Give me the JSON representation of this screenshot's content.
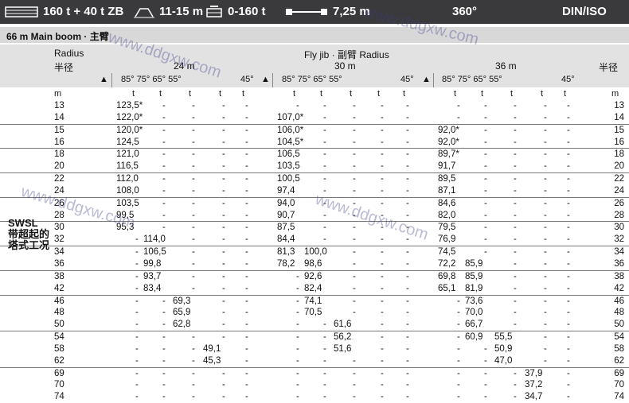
{
  "header": {
    "config": "160 t + 40 t ZB",
    "outrigger": "11-15 m",
    "counterweight": "0-160 t",
    "width": "7,25 m",
    "slew": "360°",
    "standard": "DIN/ISO"
  },
  "subheader": {
    "boom": "66 m  Main boom ·",
    "boom_cn": "主臂"
  },
  "table_header": {
    "radius": "Radius",
    "radius_cn": "半径",
    "radius_cn_right": "半径",
    "jib": "Fly jib · 副臂 Radius",
    "jib_lengths": [
      "24 m",
      "30 m",
      "36 m"
    ],
    "angles_main": "85° 75° 65° 55°",
    "angle_45": "45°",
    "unit_m": "m",
    "unit_t": "t"
  },
  "side_label": {
    "line1": "SWSL",
    "line2": "带超起的",
    "line3": "塔式工况"
  },
  "watermark": "www.ddgxw.com",
  "rows": [
    {
      "r": "13",
      "v": [
        "123,5*",
        "-",
        "-",
        "-",
        "-",
        "-",
        "-",
        "-",
        "-",
        "-",
        "-",
        "-",
        "-",
        "-",
        "-"
      ]
    },
    {
      "r": "14",
      "v": [
        "122,0*",
        "-",
        "-",
        "-",
        "-",
        "107,0*",
        "-",
        "-",
        "-",
        "-",
        "-",
        "-",
        "-",
        "-",
        "-"
      ]
    },
    {
      "r": "15",
      "v": [
        "120,0*",
        "-",
        "-",
        "-",
        "-",
        "106,0*",
        "-",
        "-",
        "-",
        "-",
        "92,0*",
        "-",
        "-",
        "-",
        "-"
      ]
    },
    {
      "r": "16",
      "v": [
        "124,5",
        "-",
        "-",
        "-",
        "-",
        "104,5*",
        "-",
        "-",
        "-",
        "-",
        "92,0*",
        "-",
        "-",
        "-",
        "-"
      ]
    },
    {
      "r": "18",
      "v": [
        "121,0",
        "-",
        "-",
        "-",
        "-",
        "106,5",
        "-",
        "-",
        "-",
        "-",
        "89,7*",
        "-",
        "-",
        "-",
        "-"
      ]
    },
    {
      "r": "20",
      "v": [
        "116,5",
        "-",
        "-",
        "-",
        "-",
        "103,5",
        "-",
        "-",
        "-",
        "-",
        "91,7",
        "-",
        "-",
        "-",
        "-"
      ]
    },
    {
      "r": "22",
      "v": [
        "112,0",
        "-",
        "-",
        "-",
        "-",
        "100,5",
        "-",
        "-",
        "-",
        "-",
        "89,5",
        "-",
        "-",
        "-",
        "-"
      ]
    },
    {
      "r": "24",
      "v": [
        "108,0",
        "-",
        "-",
        "-",
        "-",
        "97,4",
        "-",
        "-",
        "-",
        "-",
        "87,1",
        "-",
        "-",
        "-",
        "-"
      ]
    },
    {
      "r": "26",
      "v": [
        "103,5",
        "-",
        "-",
        "-",
        "-",
        "94,0",
        "-",
        "-",
        "-",
        "-",
        "84,6",
        "-",
        "-",
        "-",
        "-"
      ]
    },
    {
      "r": "28",
      "v": [
        "99,5",
        "-",
        "-",
        "-",
        "-",
        "90,7",
        "-",
        "-",
        "-",
        "-",
        "82,0",
        "-",
        "-",
        "-",
        "-"
      ]
    },
    {
      "r": "30",
      "v": [
        "95,3",
        "-",
        "-",
        "-",
        "-",
        "87,5",
        "-",
        "-",
        "-",
        "-",
        "79,5",
        "-",
        "-",
        "-",
        "-"
      ]
    },
    {
      "r": "32",
      "v": [
        "-",
        "114,0",
        "-",
        "-",
        "-",
        "84,4",
        "-",
        "-",
        "-",
        "-",
        "76,9",
        "-",
        "-",
        "-",
        "-"
      ]
    },
    {
      "r": "34",
      "v": [
        "-",
        "106,5",
        "-",
        "-",
        "-",
        "81,3",
        "100,0",
        "-",
        "-",
        "-",
        "74,5",
        "-",
        "-",
        "-",
        "-"
      ]
    },
    {
      "r": "36",
      "v": [
        "-",
        "99,8",
        "-",
        "-",
        "-",
        "78,2",
        "98,6",
        "-",
        "-",
        "-",
        "72,2",
        "85,9",
        "-",
        "-",
        "-"
      ]
    },
    {
      "r": "38",
      "v": [
        "-",
        "93,7",
        "-",
        "-",
        "-",
        "-",
        "92,6",
        "-",
        "-",
        "-",
        "69,8",
        "85,9",
        "-",
        "-",
        "-"
      ]
    },
    {
      "r": "42",
      "v": [
        "-",
        "83,4",
        "-",
        "-",
        "-",
        "-",
        "82,4",
        "-",
        "-",
        "-",
        "65,1",
        "81,9",
        "-",
        "-",
        "-"
      ]
    },
    {
      "r": "46",
      "v": [
        "-",
        "-",
        "69,3",
        "-",
        "-",
        "-",
        "74,1",
        "-",
        "-",
        "-",
        "-",
        "73,6",
        "-",
        "-",
        "-"
      ]
    },
    {
      "r": "48",
      "v": [
        "-",
        "-",
        "65,9",
        "-",
        "-",
        "-",
        "70,5",
        "-",
        "-",
        "-",
        "-",
        "70,0",
        "-",
        "-",
        "-"
      ]
    },
    {
      "r": "50",
      "v": [
        "-",
        "-",
        "62,8",
        "-",
        "-",
        "-",
        "-",
        "61,6",
        "-",
        "-",
        "-",
        "66,7",
        "-",
        "-",
        "-"
      ]
    },
    {
      "r": "54",
      "v": [
        "-",
        "-",
        "-",
        "-",
        "-",
        "-",
        "-",
        "56,2",
        "-",
        "-",
        "-",
        "60,9",
        "55,5",
        "-",
        "-"
      ]
    },
    {
      "r": "58",
      "v": [
        "-",
        "-",
        "-",
        "49,1",
        "-",
        "-",
        "-",
        "51,6",
        "-",
        "-",
        "-",
        "-",
        "50,9",
        "-",
        "-"
      ]
    },
    {
      "r": "62",
      "v": [
        "-",
        "-",
        "-",
        "45,3",
        "-",
        "-",
        "-",
        "-",
        "-",
        "-",
        "-",
        "-",
        "47,0",
        "-",
        "-"
      ]
    },
    {
      "r": "69",
      "v": [
        "-",
        "-",
        "-",
        "-",
        "-",
        "-",
        "-",
        "-",
        "-",
        "-",
        "-",
        "-",
        "-",
        "37,9",
        "-"
      ]
    },
    {
      "r": "70",
      "v": [
        "-",
        "-",
        "-",
        "-",
        "-",
        "-",
        "-",
        "-",
        "-",
        "-",
        "-",
        "-",
        "-",
        "37,2",
        "-"
      ]
    },
    {
      "r": "74",
      "v": [
        "-",
        "-",
        "-",
        "-",
        "-",
        "-",
        "-",
        "-",
        "-",
        "-",
        "-",
        "-",
        "-",
        "34,7",
        "-"
      ]
    }
  ]
}
